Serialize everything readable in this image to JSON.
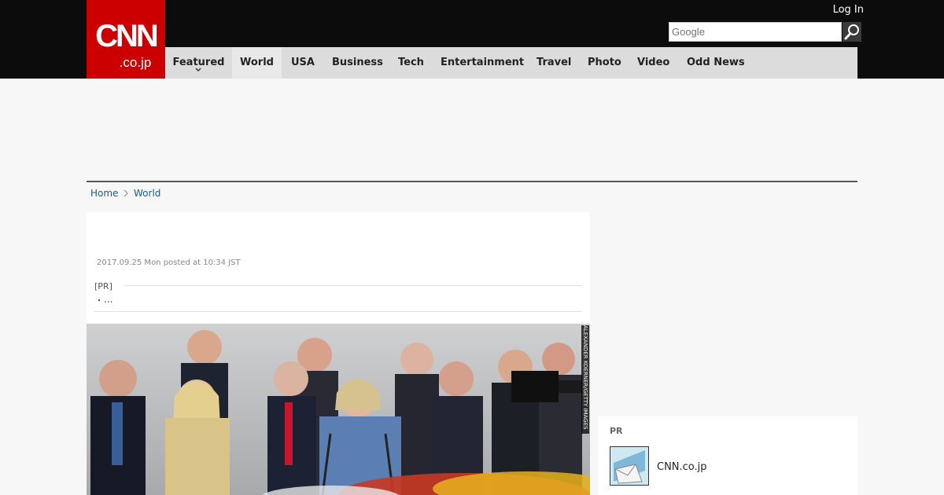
{
  "header": {
    "logo_brand": "CNN",
    "logo_suffix": ".co.jp",
    "login_label": "Log In",
    "search": {
      "placeholder": "Google",
      "value": ""
    },
    "brand_color": "#cc0000"
  },
  "nav": {
    "items": [
      {
        "label": "Featured"
      },
      {
        "label": "World"
      },
      {
        "label": "USA"
      },
      {
        "label": "Business"
      },
      {
        "label": "Tech"
      },
      {
        "label": "Entertainment"
      },
      {
        "label": "Travel"
      },
      {
        "label": "Photo"
      },
      {
        "label": "Video"
      },
      {
        "label": "Odd News"
      }
    ],
    "active": "World"
  },
  "breadcrumb": {
    "home": "Home",
    "section": "World"
  },
  "article": {
    "timestamp": "2017.09.25 Mon posted at 10:34 JST",
    "pr_label": "[PR]",
    "pr_bullet": "・",
    "pr_link": "...",
    "photo_credit": "ALEXANDER KOERNER/GETTY IMAGES"
  },
  "sidebar": {
    "pr_label": "PR",
    "pr_item": {
      "name": "CNN.co.jp",
      "icon": "mail-icon"
    }
  },
  "icons": {
    "search": "search-icon",
    "chevron": "chevron-down-icon",
    "breadcrumb_separator": "chevron-right-icon"
  }
}
